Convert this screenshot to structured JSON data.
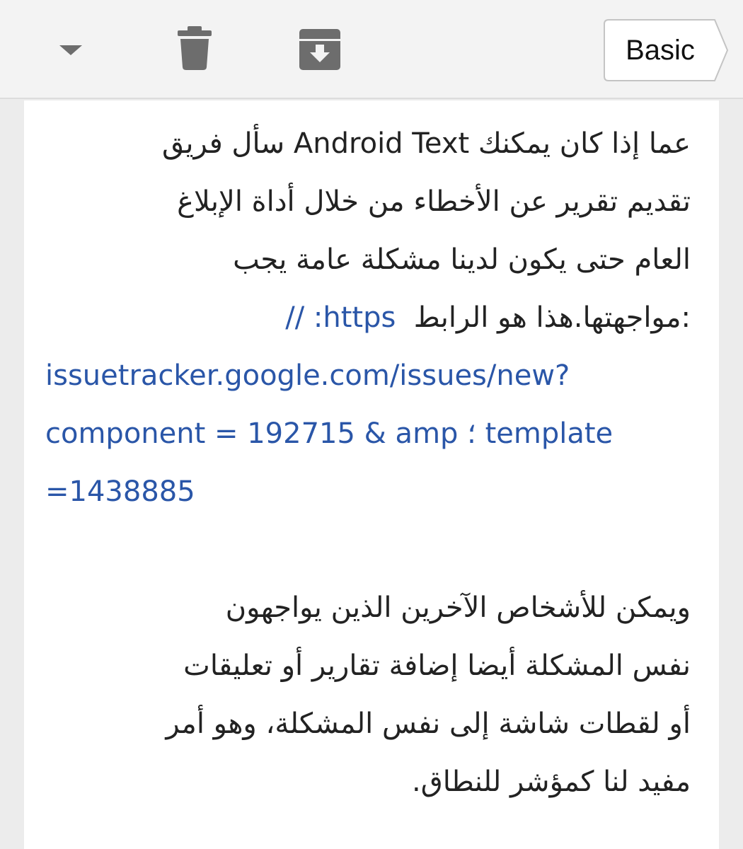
{
  "toolbar": {
    "dropdown_icon": "caret-down-icon",
    "delete_icon": "trash-icon",
    "archive_icon": "archive-icon",
    "basic_label": "Basic",
    "icon_color": "#6d6d6d"
  },
  "message": {
    "para1_line1": "عما إذا كان يمكنك Android Text سأل فريق",
    "para1_line2": "تقديم تقرير عن الأخطاء من خلال أداة الإبلاغ",
    "para1_line3": "العام حتى يكون لدينا مشكلة عامة يجب",
    "para1_line4_text": ":مواجهتها.هذا هو الرابط",
    "link_part1": "https: //",
    "link_part2": "issuetracker.google.com/issues/new?",
    "link_part3": "component = 192715 & amp ؛ template",
    "link_part4": "=1438885",
    "link_color": "#2a56a8",
    "para2_line1": "ويمكن للأشخاص الآخرين الذين يواجهون",
    "para2_line2": "نفس المشكلة أيضا إضافة تقارير أو تعليقات",
    "para2_line3": "أو لقطات شاشة إلى نفس المشكلة، وهو أمر",
    "para2_line4": "مفيد لنا كمؤشر للنطاق."
  }
}
